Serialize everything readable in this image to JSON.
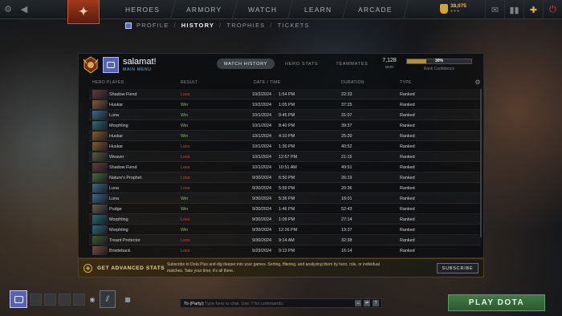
{
  "topbar": {
    "nav": [
      "HEROES",
      "ARMORY",
      "WATCH",
      "LEARN",
      "ARCADE"
    ],
    "gold": {
      "value": "38,075",
      "sub": "●●●"
    }
  },
  "subnav": {
    "items": [
      "PROFILE",
      "HISTORY",
      "TROPHIES",
      "TICKETS"
    ],
    "separator": "/"
  },
  "profile": {
    "name": "salamat!",
    "sub": "MAIN MENU",
    "tabs": [
      "MATCH HISTORY",
      "HERO STATS",
      "TEAMMATES"
    ],
    "mmr_value": "7,128",
    "mmr_label": "MMR",
    "confidence_text": "30%",
    "confidence_fraction": 0.3,
    "confidence_label": "Rank Confidence"
  },
  "table": {
    "headers": {
      "hero": "HERO PLAYED",
      "result": "RESULT",
      "date": "DATE / TIME",
      "duration": "DURATION",
      "type": "TYPE"
    },
    "rows": [
      {
        "hero": "Shadow Fiend",
        "result": "Loss",
        "date": "10/2/2024",
        "time": "1:54 PM",
        "duration": "22:33",
        "type": "Ranked",
        "color": "#6a3a3a"
      },
      {
        "hero": "Huskar",
        "result": "Win",
        "date": "10/2/2024",
        "time": "1:05 PM",
        "duration": "37:25",
        "type": "Ranked",
        "color": "#8a5a2a"
      },
      {
        "hero": "Luna",
        "result": "Win",
        "date": "10/1/2024",
        "time": "9:45 PM",
        "duration": "31:07",
        "type": "Ranked",
        "color": "#3a6a8a"
      },
      {
        "hero": "Morphling",
        "result": "Win",
        "date": "10/1/2024",
        "time": "8:40 PM",
        "duration": "39:37",
        "type": "Ranked",
        "color": "#2a6a7a"
      },
      {
        "hero": "Huskar",
        "result": "Win",
        "date": "10/1/2024",
        "time": "4:10 PM",
        "duration": "25:20",
        "type": "Ranked",
        "color": "#8a5a2a"
      },
      {
        "hero": "Huskar",
        "result": "Loss",
        "date": "10/1/2024",
        "time": "1:30 PM",
        "duration": "40:52",
        "type": "Ranked",
        "color": "#8a5a2a"
      },
      {
        "hero": "Weaver",
        "result": "Loss",
        "date": "10/1/2024",
        "time": "12:57 PM",
        "duration": "21:15",
        "type": "Ranked",
        "color": "#5a5a3a"
      },
      {
        "hero": "Shadow Fiend",
        "result": "Loss",
        "date": "10/1/2024",
        "time": "10:51 AM",
        "duration": "49:51",
        "type": "Ranked",
        "color": "#6a3a3a"
      },
      {
        "hero": "Nature's Prophet",
        "result": "Loss",
        "date": "9/30/2024",
        "time": "6:50 PM",
        "duration": "26:19",
        "type": "Ranked",
        "color": "#4a6a3a"
      },
      {
        "hero": "Luna",
        "result": "Loss",
        "date": "9/30/2024",
        "time": "5:59 PM",
        "duration": "20:36",
        "type": "Ranked",
        "color": "#3a6a8a"
      },
      {
        "hero": "Luna",
        "result": "Win",
        "date": "9/30/2024",
        "time": "5:36 PM",
        "duration": "16:01",
        "type": "Ranked",
        "color": "#3a6a8a"
      },
      {
        "hero": "Pudge",
        "result": "Win",
        "date": "9/30/2024",
        "time": "1:46 PM",
        "duration": "52:43",
        "type": "Ranked",
        "color": "#6a5a4a"
      },
      {
        "hero": "Morphling",
        "result": "Loss",
        "date": "9/30/2024",
        "time": "1:09 PM",
        "duration": "27:14",
        "type": "Ranked",
        "color": "#2a6a7a"
      },
      {
        "hero": "Morphling",
        "result": "Win",
        "date": "9/30/2024",
        "time": "12:26 PM",
        "duration": "19:37",
        "type": "Ranked",
        "color": "#2a6a7a"
      },
      {
        "hero": "Treant Protector",
        "result": "Loss",
        "date": "9/30/2024",
        "time": "9:14 AM",
        "duration": "32:38",
        "type": "Ranked",
        "color": "#3a5a2a"
      },
      {
        "hero": "Bristleback",
        "result": "Loss",
        "date": "9/29/2024",
        "time": "9:13 PM",
        "duration": "16:14",
        "type": "Ranked",
        "color": "#7a4a3a"
      }
    ]
  },
  "promo": {
    "title": "GET ADVANCED STATS",
    "text": "Subscribe to Dota Plus and dig deeper into your games. Sorting, filtering, and analyzing them by hero, role, or individual matches. Take your time; it's all there.",
    "button": "SUBSCRIBE"
  },
  "chat": {
    "channel": "To (Party):",
    "placeholder": "Type here to chat. Use '/' for commands."
  },
  "play_button": "PLAY DOTA",
  "colors": {
    "win": "#79c63b",
    "loss": "#d0463a",
    "gold": "#e8c25a",
    "accent": "#5563b6"
  }
}
